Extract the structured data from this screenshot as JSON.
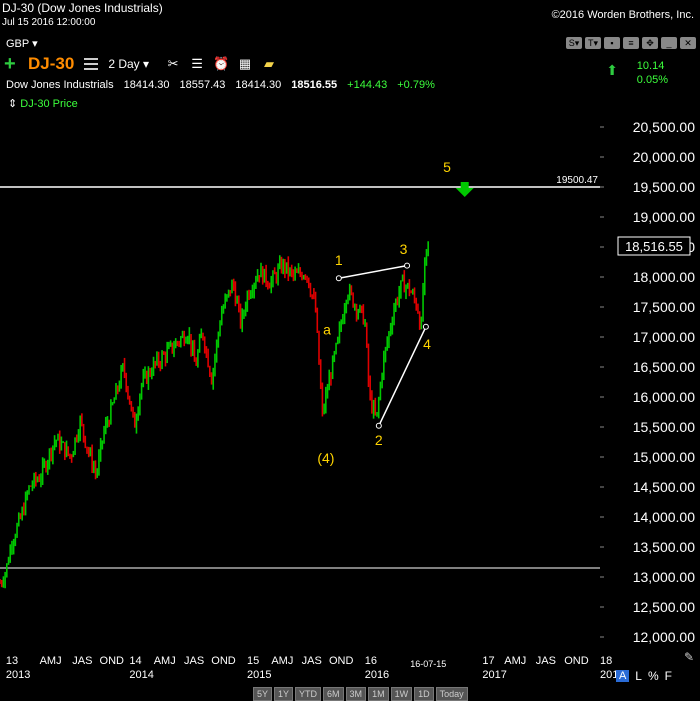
{
  "header": {
    "title": "DJ-30 (Dow Jones Industrials)",
    "datetime": "Jul 15 2016 12:00:00",
    "copyright": "©2016 Worden Brothers, Inc.",
    "currency": "GBP"
  },
  "toolbar": {
    "symbol": "DJ-30",
    "interval": "2 Day"
  },
  "quote": {
    "name": "Dow Jones Industrials",
    "open": "18414.30",
    "high": "18557.43",
    "low": "18414.30",
    "close": "18516.55",
    "change": "+144.43",
    "change_pct": "+0.79%"
  },
  "legend_label": "DJ-30 Price",
  "right_change": {
    "value": "10.14",
    "pct": "0.05%"
  },
  "bottom_buttons": [
    "5Y",
    "1Y",
    "YTD",
    "6M",
    "3M",
    "1M",
    "1W",
    "1D",
    "Today"
  ],
  "bottom_right": {
    "a": "A",
    "l": "L",
    "pct": "%",
    "f": "F"
  },
  "colors": {
    "up": "#00c800",
    "down": "#e00000",
    "annotation": "#ffd400",
    "arrow": "#00c800",
    "symbol": "#ff8c00"
  },
  "chart_data": {
    "type": "line",
    "title": "DJ-30 (Dow Jones Industrials)",
    "ylim": [
      11750,
      20750
    ],
    "yticks": [
      {
        "value": 12000,
        "label": "12,000.00"
      },
      {
        "value": 12500,
        "label": "12,500.00"
      },
      {
        "value": 13000,
        "label": "13,000.00"
      },
      {
        "value": 13500,
        "label": "13,500.00"
      },
      {
        "value": 14000,
        "label": "14,000.00"
      },
      {
        "value": 14500,
        "label": "14,500.00"
      },
      {
        "value": 15000,
        "label": "15,000.00"
      },
      {
        "value": 15500,
        "label": "15,500.00"
      },
      {
        "value": 16000,
        "label": "16,000.00"
      },
      {
        "value": 16500,
        "label": "16,500.00"
      },
      {
        "value": 17000,
        "label": "17,000.00"
      },
      {
        "value": 17500,
        "label": "17,500.00"
      },
      {
        "value": 18000,
        "label": "18,000.00"
      },
      {
        "value": 18500,
        "label": "18,500.00"
      },
      {
        "value": 19000,
        "label": "19,000.00"
      },
      {
        "value": 19500,
        "label": "19,500.00"
      },
      {
        "value": 20000,
        "label": "20,000.00"
      },
      {
        "value": 20500,
        "label": "20,500.00"
      }
    ],
    "xlim": [
      2012.9,
      2018.0
    ],
    "xticks": [
      {
        "t": 2012.95,
        "label": "13"
      },
      {
        "t": 2013.33,
        "label": "AMJ"
      },
      {
        "t": 2013.6,
        "label": "JAS"
      },
      {
        "t": 2013.85,
        "label": "OND"
      },
      {
        "t": 2014.0,
        "label": "14"
      },
      {
        "t": 2014.3,
        "label": "AMJ"
      },
      {
        "t": 2014.55,
        "label": "JAS"
      },
      {
        "t": 2014.8,
        "label": "OND"
      },
      {
        "t": 2015.0,
        "label": "15"
      },
      {
        "t": 2015.3,
        "label": "AMJ"
      },
      {
        "t": 2015.55,
        "label": "JAS"
      },
      {
        "t": 2015.8,
        "label": "OND"
      },
      {
        "t": 2016.0,
        "label": "16"
      },
      {
        "t": 2016.54,
        "label": "16-07-15"
      },
      {
        "t": 2017.0,
        "label": "17"
      },
      {
        "t": 2017.28,
        "label": "AMJ"
      },
      {
        "t": 2017.54,
        "label": "JAS"
      },
      {
        "t": 2017.8,
        "label": "OND"
      },
      {
        "t": 2018.0,
        "label": "18"
      }
    ],
    "xyears": [
      {
        "t": 2012.95,
        "label": "2013"
      },
      {
        "t": 2014.0,
        "label": "2014"
      },
      {
        "t": 2015.0,
        "label": "2015"
      },
      {
        "t": 2016.0,
        "label": "2016"
      },
      {
        "t": 2017.0,
        "label": "2017"
      },
      {
        "t": 2018.0,
        "label": "2018"
      }
    ],
    "price_path": [
      [
        2012.9,
        12900
      ],
      [
        2012.95,
        13100
      ],
      [
        2013.0,
        13600
      ],
      [
        2013.08,
        14000
      ],
      [
        2013.15,
        14500
      ],
      [
        2013.25,
        14700
      ],
      [
        2013.37,
        15300
      ],
      [
        2013.42,
        15200
      ],
      [
        2013.5,
        15000
      ],
      [
        2013.58,
        15600
      ],
      [
        2013.65,
        15100
      ],
      [
        2013.72,
        14700
      ],
      [
        2013.78,
        15400
      ],
      [
        2013.85,
        15800
      ],
      [
        2013.95,
        16500
      ],
      [
        2014.04,
        15500
      ],
      [
        2014.1,
        16200
      ],
      [
        2014.2,
        16500
      ],
      [
        2014.3,
        16700
      ],
      [
        2014.4,
        16900
      ],
      [
        2014.5,
        17100
      ],
      [
        2014.56,
        16500
      ],
      [
        2014.62,
        17100
      ],
      [
        2014.7,
        16300
      ],
      [
        2014.78,
        17400
      ],
      [
        2014.88,
        17900
      ],
      [
        2014.95,
        17200
      ],
      [
        2015.0,
        17700
      ],
      [
        2015.1,
        18100
      ],
      [
        2015.2,
        17900
      ],
      [
        2015.3,
        18200
      ],
      [
        2015.4,
        18000
      ],
      [
        2015.5,
        18100
      ],
      [
        2015.58,
        17500
      ],
      [
        2015.64,
        15700
      ],
      [
        2015.7,
        16300
      ],
      [
        2015.77,
        16900
      ],
      [
        2015.85,
        17800
      ],
      [
        2015.93,
        17500
      ],
      [
        2016.0,
        17300
      ],
      [
        2016.04,
        16000
      ],
      [
        2016.1,
        15600
      ],
      [
        2016.15,
        16500
      ],
      [
        2016.25,
        17500
      ],
      [
        2016.32,
        17900
      ],
      [
        2016.38,
        17800
      ],
      [
        2016.45,
        17500
      ],
      [
        2016.48,
        17100
      ],
      [
        2016.5,
        18000
      ],
      [
        2016.54,
        18550
      ]
    ],
    "hlines": [
      {
        "value": 19500.47,
        "label": "19500.47",
        "color": "#ffffff"
      },
      {
        "value": 13150,
        "color": "#aaaaaa"
      }
    ],
    "lines": [
      {
        "from": [
          2015.78,
          17980
        ],
        "to": [
          2016.36,
          18190
        ],
        "color": "#ffffff"
      },
      {
        "from": [
          2016.12,
          15520
        ],
        "to": [
          2016.52,
          17170
        ],
        "color": "#ffffff"
      }
    ],
    "annotations": [
      {
        "t": 2015.78,
        "v": 18200,
        "text": "1"
      },
      {
        "t": 2016.33,
        "v": 18380,
        "text": "3"
      },
      {
        "t": 2016.53,
        "v": 16800,
        "text": "4"
      },
      {
        "t": 2016.12,
        "v": 15200,
        "text": "2"
      },
      {
        "t": 2015.68,
        "v": 17040,
        "text": "a"
      },
      {
        "t": 2015.67,
        "v": 14900,
        "text": "(4)"
      },
      {
        "t": 2016.7,
        "v": 19750,
        "text": "5"
      }
    ],
    "last_price": {
      "value": 18516.55,
      "label": "18,516.55"
    },
    "arrow": {
      "t": 2016.85,
      "v": 19450
    }
  }
}
